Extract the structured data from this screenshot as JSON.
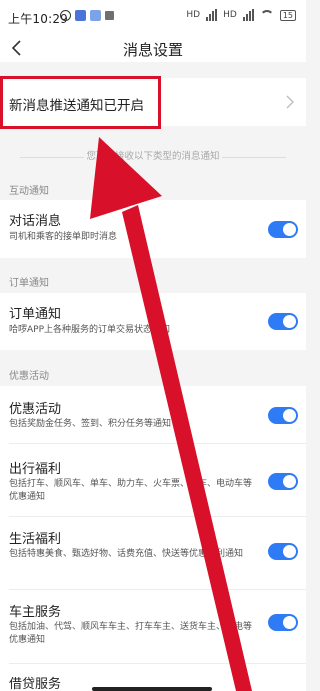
{
  "status_bar": {
    "time": "上午10:29",
    "signal_1": "HD",
    "signal_2": "HD",
    "battery": "15"
  },
  "header": {
    "title": "消息设置"
  },
  "push": {
    "label": "新消息推送通知已开启"
  },
  "hint": "您可以接收以下类型的消息通知",
  "sections": {
    "interaction": {
      "label": "互动通知",
      "items": [
        {
          "title": "对话消息",
          "desc": "司机和乘客的接单即时消息",
          "enabled": true
        }
      ]
    },
    "order": {
      "label": "订单通知",
      "items": [
        {
          "title": "订单通知",
          "desc": "哈啰APP上各种服务的订单交易状态通知",
          "enabled": true
        }
      ]
    },
    "promo": {
      "label": "优惠活动",
      "items": [
        {
          "title": "优惠活动",
          "desc": "包括奖励金任务、签到、积分任务等通知",
          "enabled": true
        },
        {
          "title": "出行福利",
          "desc": "包括打车、顺风车、单车、助力车、火车票、汽车、电动车等优惠通知",
          "enabled": true
        },
        {
          "title": "生活福利",
          "desc": "包括特惠美食、甄选好物、话费充值、快送等优惠福利通知",
          "enabled": true
        },
        {
          "title": "车主服务",
          "desc": "包括加油、代驾、顺风车车主、打车车主、送货车主、充电等优惠通知",
          "enabled": true
        },
        {
          "title": "借贷服务",
          "desc": "",
          "enabled": true
        }
      ]
    }
  },
  "colors": {
    "toggle_on": "#2f7bf5",
    "annotation_red": "#d8102a"
  },
  "icons": {
    "back": "chevron-left-icon",
    "push_arrow": "chevron-right-icon"
  }
}
